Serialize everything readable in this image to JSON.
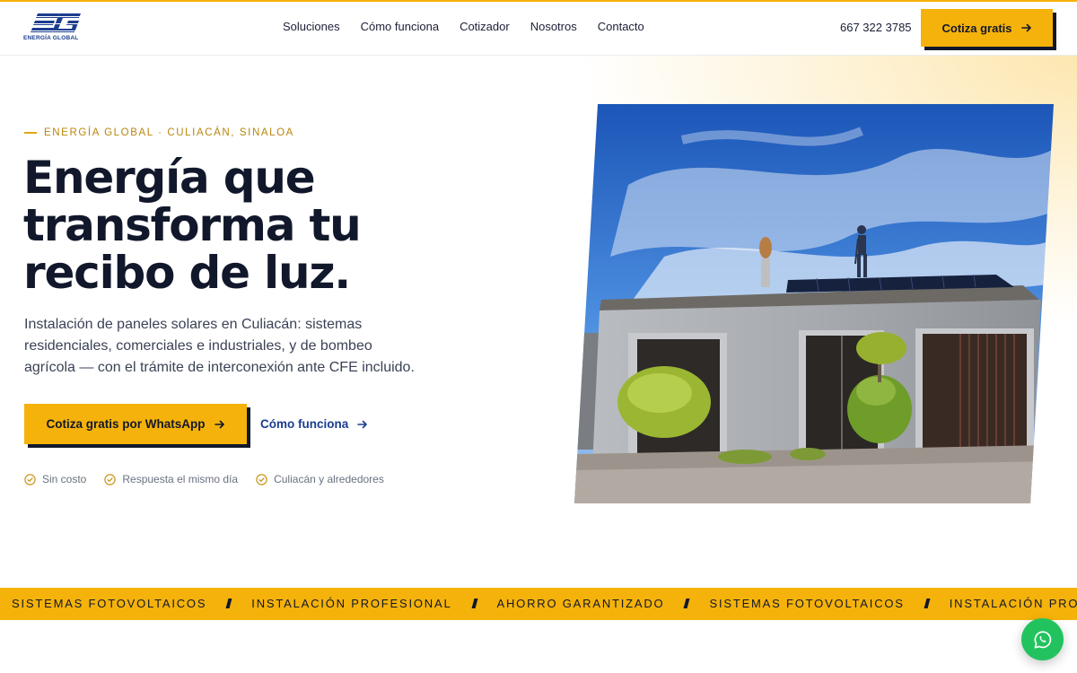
{
  "brand": {
    "logo_text": "ENERGÍA GLOBAL"
  },
  "nav": {
    "items": [
      "Soluciones",
      "Cómo funciona",
      "Cotizador",
      "Nosotros",
      "Contacto"
    ],
    "phone": "667 322 3785",
    "cta_label": "Cotiza gratis"
  },
  "hero": {
    "eyebrow": "ENERGÍA GLOBAL · CULIACÁN, SINALOA",
    "title_lines": [
      "Energía que",
      "transforma tu",
      "recibo de luz."
    ],
    "lead": "Instalación de paneles solares en Culiacán: sistemas residenciales, comerciales e industriales, y de bombeo agrícola — con el trámite de interconexión ante CFE incluido.",
    "primary_cta": "Cotiza gratis por WhatsApp",
    "secondary_cta": "Cómo funciona",
    "features": [
      "Sin costo",
      "Respuesta el mismo día",
      "Culiacán y alrededores"
    ]
  },
  "ticker": {
    "items": [
      "SISTEMAS FOTOVOLTAICOS",
      "INSTALACIÓN PROFESIONAL",
      "AHORRO GARANTIZADO",
      "SISTEMAS FOTOVOLTAICOS",
      "INSTALACIÓN PROFESIONAL"
    ]
  },
  "icons": {
    "arrow": "arrow-right-icon",
    "check": "check-circle-icon",
    "whatsapp": "whatsapp-icon"
  },
  "colors": {
    "accent": "#f5b20a",
    "ink": "#12182b",
    "link": "#1b3d8f",
    "whatsapp": "#22c35e"
  }
}
